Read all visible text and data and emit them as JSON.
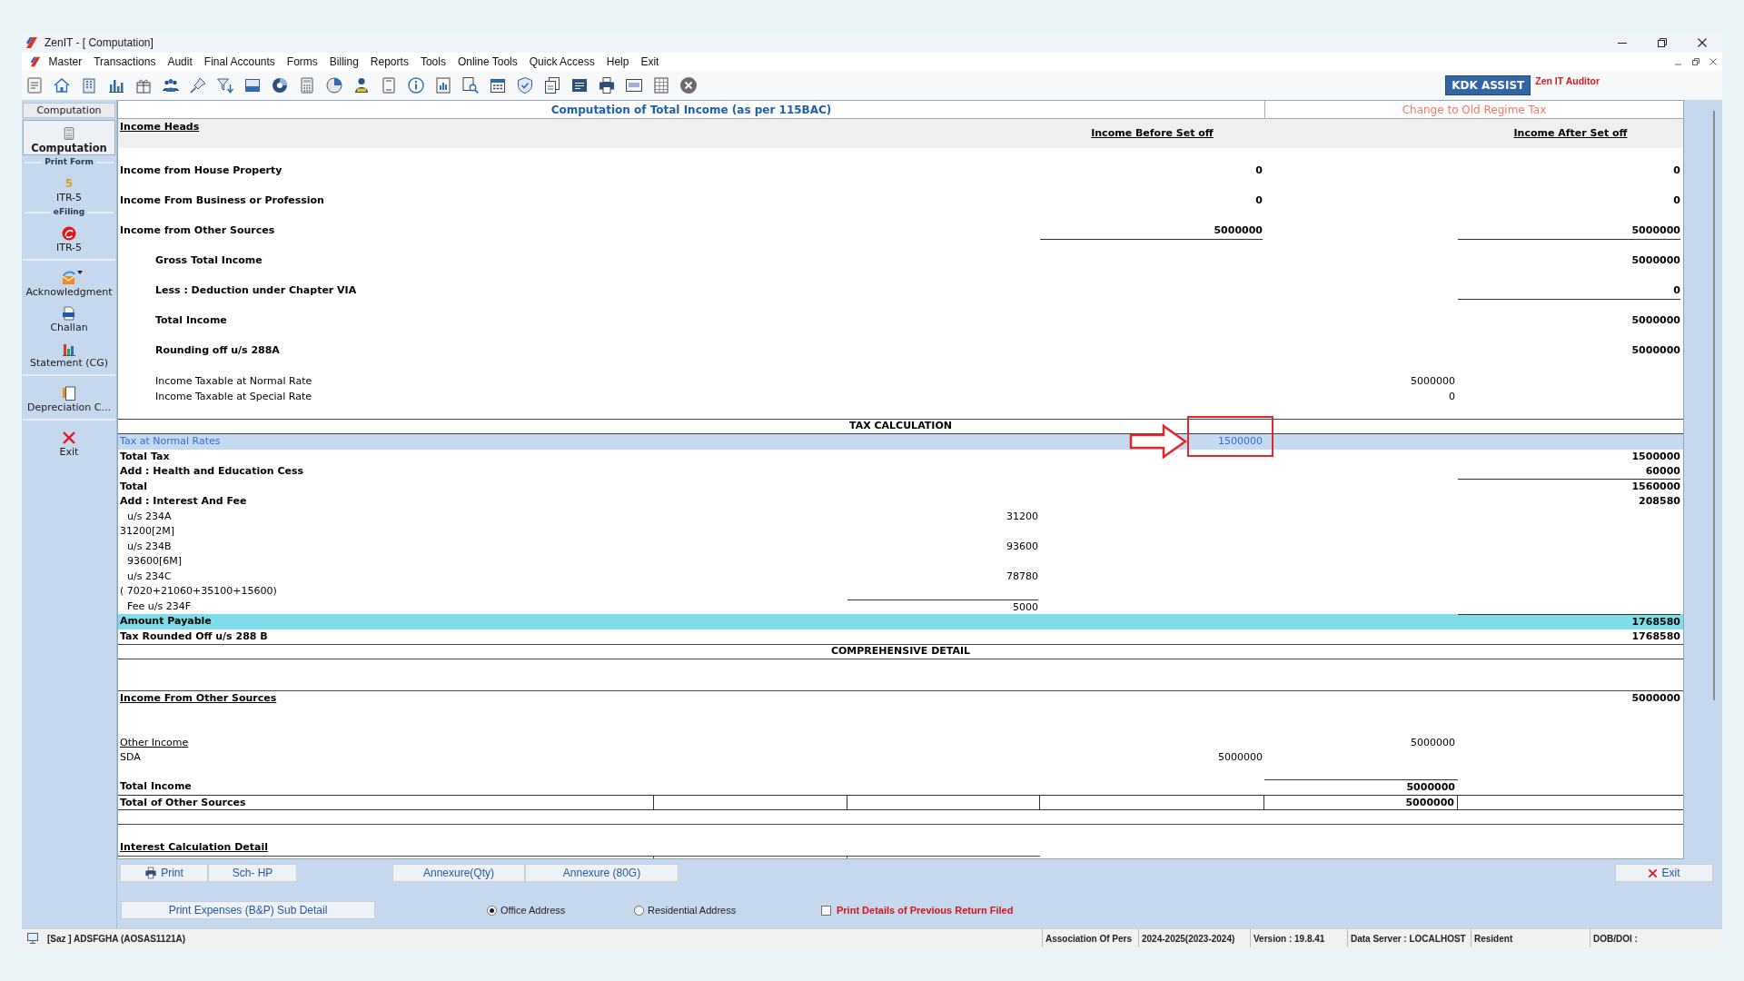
{
  "window": {
    "title": "ZenIT - [ Computation]"
  },
  "menu": [
    "Master",
    "Transactions",
    "Audit",
    "Final Accounts",
    "Forms",
    "Billing",
    "Reports",
    "Tools",
    "Online Tools",
    "Quick Access",
    "Help",
    "Exit"
  ],
  "toolbar": {
    "assist_button": "KDK ASSIST",
    "product_name": "Zen IT Auditor"
  },
  "sidebar": {
    "title": "Computation",
    "groups": [
      {
        "items": [
          {
            "label": "Computation",
            "selected": true
          }
        ]
      },
      {
        "title": "Print Form",
        "items": [
          {
            "label": "ITR-5",
            "icon_text": "5",
            "selected": false
          }
        ]
      },
      {
        "title": "eFiling",
        "items": [
          {
            "label": "ITR-5",
            "selected": false
          }
        ]
      },
      {
        "items": [
          {
            "label": "Acknowledgment",
            "selected": false
          },
          {
            "label": "Challan",
            "selected": false
          },
          {
            "label": "Statement (CG)",
            "selected": false
          }
        ]
      },
      {
        "items": [
          {
            "label": "Depreciation C...",
            "selected": false
          }
        ]
      },
      {
        "items": [
          {
            "label": "Exit",
            "selected": false
          }
        ]
      }
    ]
  },
  "report": {
    "title": "Computation of Total Income (as per 115BAC)",
    "regime_link": "Change to Old Regime Tax",
    "heading": "Income Heads",
    "columns": [
      "Income Before Set off",
      "Income After Set off"
    ],
    "income_rows": [
      {
        "kind": "head",
        "label": "Income from House Property",
        "before": "0",
        "after": "0",
        "rule_below": false
      },
      {
        "kind": "head",
        "label": "Income From Business or Profession",
        "before": "0",
        "after": "0",
        "rule_below": false
      },
      {
        "kind": "head",
        "label": "Income from Other Sources",
        "before": "5000000",
        "after": "5000000",
        "rule_below": true
      },
      {
        "kind": "subtotal",
        "label": "Gross Total Income",
        "after": "5000000",
        "rule_below": false
      },
      {
        "kind": "subtotal",
        "label": "Less : Deduction under Chapter VIA",
        "after": "0",
        "rule_below": true
      },
      {
        "kind": "subtotal",
        "label": "Total Income",
        "after": "5000000",
        "rule_below": false
      },
      {
        "kind": "subtotal",
        "label": "Rounding off u/s 288A",
        "after": "5000000",
        "rule_below": false
      }
    ],
    "taxable_rows": [
      {
        "label": "Income Taxable at Normal Rate",
        "amount": "5000000"
      },
      {
        "label": "Income Taxable at Special Rate",
        "amount": "0"
      }
    ]
  },
  "tax_calculation": {
    "title": "TAX CALCULATION",
    "rows": [
      {
        "kind": "plain",
        "label": "Tax at Normal Rates",
        "column_4": "1500000",
        "selected": true,
        "annotated": true,
        "rule_above": false,
        "rule_below": false
      },
      {
        "kind": "bold",
        "label": "Total Tax",
        "column_6": "1500000",
        "selected": false,
        "annotated": false,
        "rule_above": false,
        "rule_below": false
      },
      {
        "kind": "bold",
        "label": "Add : Health and Education Cess",
        "column_6": "60000",
        "selected": false,
        "annotated": false,
        "rule_above": false,
        "rule_below": true
      },
      {
        "kind": "bold",
        "label": "Total",
        "column_6": "1560000",
        "selected": false,
        "annotated": false,
        "rule_above": false,
        "rule_below": false
      },
      {
        "kind": "bold",
        "label": "Add : Interest And Fee",
        "column_6": "208580",
        "selected": false,
        "annotated": false,
        "rule_above": false,
        "rule_below": false
      },
      {
        "kind": "indented",
        "label": "u/s 234A",
        "column_3": "31200",
        "selected": false,
        "annotated": false,
        "rule_above": false,
        "rule_below": false
      },
      {
        "kind": "plain",
        "label": "31200[2M]",
        "selected": false,
        "annotated": false,
        "rule_above": false,
        "rule_below": false
      },
      {
        "kind": "indented",
        "label": "u/s 234B",
        "column_3": "93600",
        "selected": false,
        "annotated": false,
        "rule_above": false,
        "rule_below": false
      },
      {
        "kind": "indented",
        "label": "93600[6M]",
        "selected": false,
        "annotated": false,
        "rule_above": false,
        "rule_below": false
      },
      {
        "kind": "indented",
        "label": "u/s 234C",
        "column_3": "78780",
        "selected": false,
        "annotated": false,
        "rule_above": false,
        "rule_below": false
      },
      {
        "kind": "plain",
        "label": "( 7020+21060+35100+15600)",
        "selected": false,
        "annotated": false,
        "rule_above": false,
        "rule_below": false
      },
      {
        "kind": "indented",
        "label": "Fee u/s 234F",
        "column_3": "5000",
        "selected": false,
        "annotated": false,
        "rule_above": true,
        "rule_below": false
      },
      {
        "kind": "payable",
        "label": "Amount Payable",
        "column_6": "1768580",
        "selected": false,
        "annotated": false,
        "rule_above": true,
        "rule_below": false
      },
      {
        "kind": "bold",
        "label": "Tax Rounded Off u/s 288 B",
        "column_6": "1768580",
        "selected": false,
        "annotated": false,
        "rule_above": false,
        "rule_below": false
      }
    ]
  },
  "comprehensive_detail": {
    "title": "COMPREHENSIVE DETAIL",
    "heading": "Income From Other Sources",
    "heading_amount": "5000000",
    "subheading": "Other Income",
    "subheading_amount": "5000000",
    "items": [
      {
        "label": "SDA",
        "amount": "5000000"
      }
    ],
    "total": {
      "label": "Total Income",
      "amount": "5000000"
    },
    "summary": {
      "label": "Total of Other Sources",
      "amount": "5000000"
    },
    "interest_heading": "Interest Calculation Detail"
  },
  "actions": {
    "print_buttons": [
      "Print",
      "Sch- HP"
    ],
    "annexure_buttons": [
      "Annexure(Qty)",
      "Annexure (80G)"
    ],
    "exit_button": "Exit",
    "expenses_button": "Print Expenses (B&P) Sub Detail",
    "address_options": [
      {
        "label": "Office Address",
        "selected": true
      },
      {
        "label": "Residential Address",
        "selected": false
      }
    ],
    "previous_return": {
      "label": "Print Details of Previous Return Filed",
      "checked": false
    }
  },
  "status_bar": {
    "assessee": "[Saz ] ADSFGHA (AOSAS1121A)",
    "panes": [
      "Association Of Pers",
      "2024-2025(2023-2024)",
      "Version : 19.8.41",
      "Data Server : LOCALHOST",
      "Resident",
      "DOB/DOI :"
    ]
  }
}
